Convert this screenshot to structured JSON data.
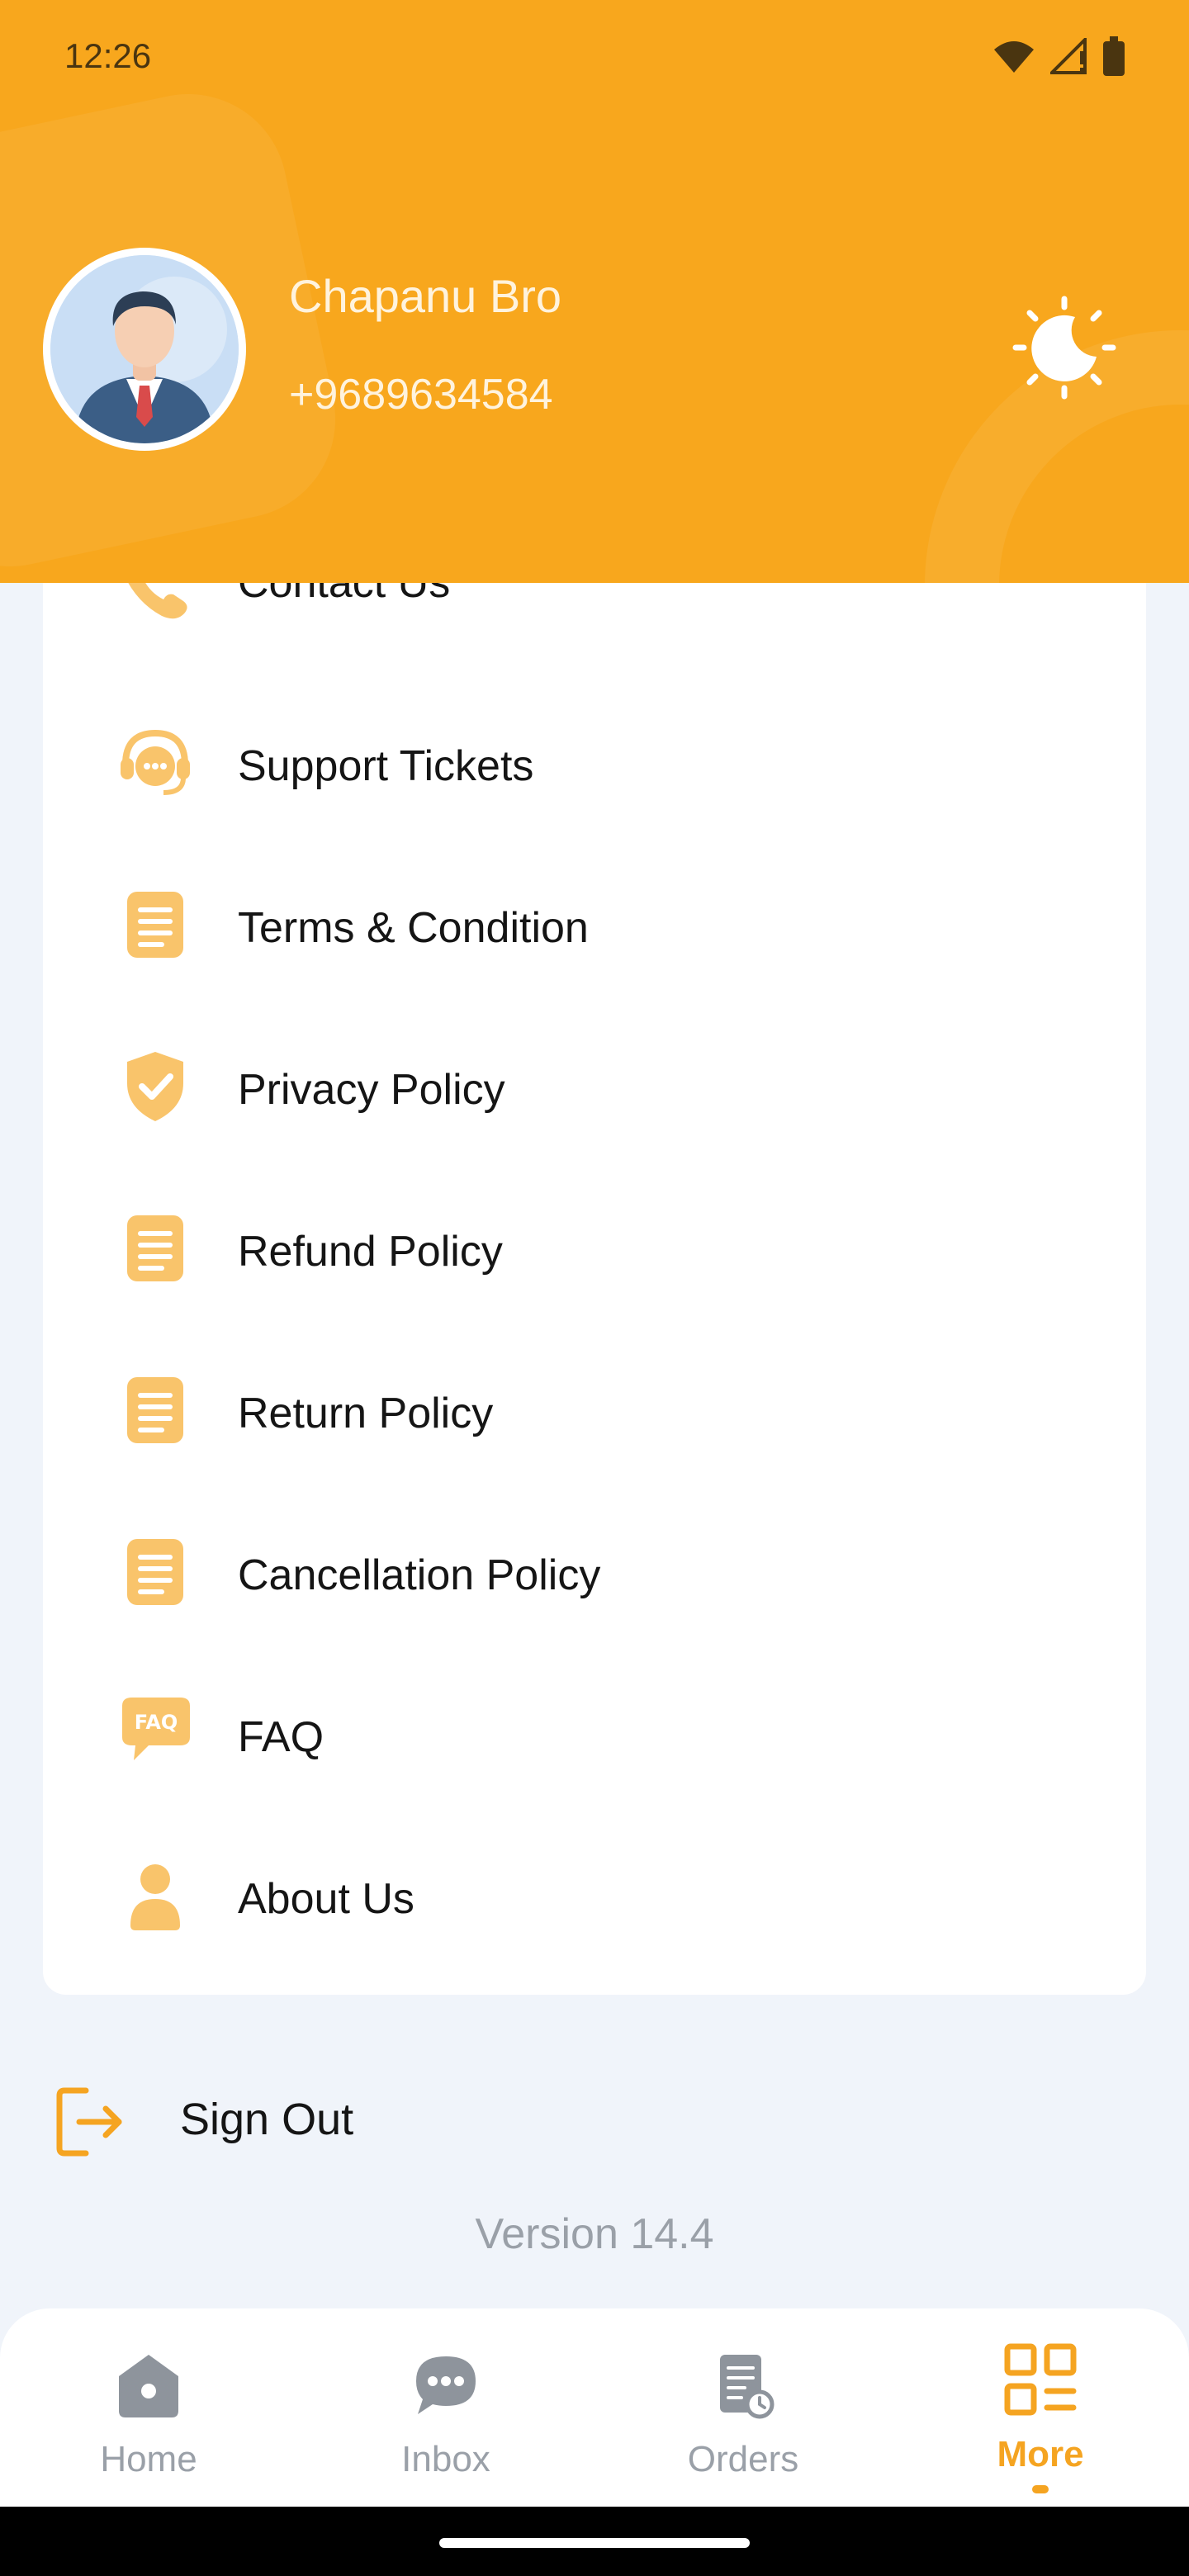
{
  "status_bar": {
    "time": "12:26"
  },
  "profile": {
    "name": "Chapanu Bro",
    "phone": "+9689634584"
  },
  "menu": {
    "items": [
      {
        "label": "Contact Us",
        "icon": "phone-icon"
      },
      {
        "label": "Support Tickets",
        "icon": "support-headset-icon"
      },
      {
        "label": "Terms & Condition",
        "icon": "document-icon"
      },
      {
        "label": "Privacy Policy",
        "icon": "shield-check-icon"
      },
      {
        "label": "Refund Policy",
        "icon": "document-icon"
      },
      {
        "label": "Return Policy",
        "icon": "document-icon"
      },
      {
        "label": "Cancellation Policy",
        "icon": "document-icon"
      },
      {
        "label": "FAQ",
        "icon": "faq-bubble-icon"
      },
      {
        "label": "About Us",
        "icon": "person-icon"
      }
    ]
  },
  "sign_out": {
    "label": "Sign Out"
  },
  "version": "Version 14.4",
  "bottom_nav": {
    "tabs": [
      {
        "label": "Home",
        "icon": "home-icon"
      },
      {
        "label": "Inbox",
        "icon": "chat-icon"
      },
      {
        "label": "Orders",
        "icon": "orders-icon"
      },
      {
        "label": "More",
        "icon": "grid-menu-icon",
        "active": true
      }
    ]
  },
  "colors": {
    "accent": "#f8a71d",
    "icon_tint": "#f9c46b",
    "active_tab": "#f5a421",
    "inactive_tab": "#9aa0a8",
    "background": "#f0f4fa"
  }
}
